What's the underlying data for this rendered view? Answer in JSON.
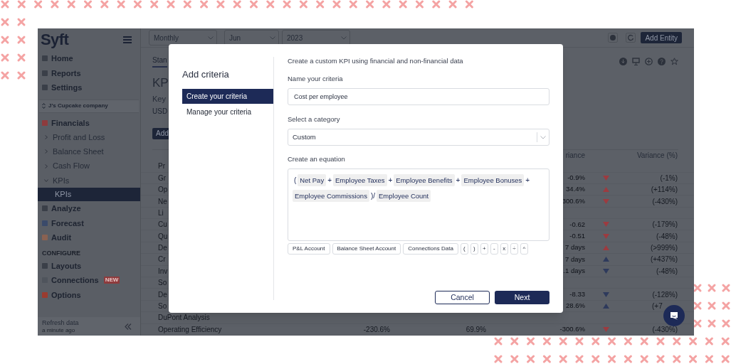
{
  "sidebar": {
    "logo": "Syft",
    "top_items": [
      {
        "label": "Home",
        "selected": false
      },
      {
        "label": "Reports",
        "selected": false
      },
      {
        "label": "Settings",
        "selected": false
      }
    ],
    "company": "J's Cupcake company",
    "financials": {
      "label": "Financials",
      "selected": false,
      "children": [
        {
          "label": "Profit and Loss",
          "expanded": false,
          "selected": false
        },
        {
          "label": "Balance Sheet",
          "expanded": false,
          "selected": false
        },
        {
          "label": "Cash Flow",
          "expanded": false,
          "selected": false
        },
        {
          "label": "KPIs",
          "expanded": true,
          "selected": false,
          "children": [
            {
              "label": "KPIs",
              "selected": true
            }
          ]
        }
      ]
    },
    "tool_items": [
      {
        "label": "Analyze",
        "selected": false
      },
      {
        "label": "Forecast",
        "selected": false
      },
      {
        "label": "Audit",
        "selected": false
      }
    ],
    "configure_heading": "CONFIGURE",
    "configure_items": [
      {
        "label": "Layouts",
        "selected": false
      },
      {
        "label": "Connections",
        "badge": "NEW",
        "selected": false
      },
      {
        "label": "Options",
        "selected": false
      }
    ],
    "refresh": {
      "label": "Refresh data",
      "time": "a minute ago"
    }
  },
  "toolbar": {
    "period": "Monthly",
    "month": "Jun",
    "year": "2023",
    "add_entity": "Add Entity"
  },
  "tab": "Stan",
  "heading": "KP",
  "subtitle": "Key",
  "currency": "USD",
  "add_button": "Add",
  "table": {
    "variance_header": "riance",
    "variance_pct_header": "Variance (%)",
    "rows": [
      {
        "kind": "section",
        "label": "Pr"
      },
      {
        "kind": "metric",
        "label": "Gr",
        "variance": "-0.9%",
        "trend_up": false,
        "color": "#9c3b40",
        "variance_pct": "(-1%)"
      },
      {
        "kind": "metric",
        "label": "Op",
        "variance": "34.4%",
        "trend_up": true,
        "color": "#9c3b40",
        "variance_pct": "(+114%)"
      },
      {
        "kind": "metric",
        "label": "Ne",
        "variance": "300.6%",
        "trend_up": false,
        "color": "#9c3b40",
        "variance_pct": "(-430%)"
      },
      {
        "kind": "section",
        "label": "Li"
      },
      {
        "kind": "metric",
        "label": "Cu",
        "variance": "-0.62",
        "trend_up": false,
        "color": "#9c3b40",
        "variance_pct": "(-179%)"
      },
      {
        "kind": "metric",
        "label": "Qu",
        "variance": "-0.51",
        "trend_up": false,
        "color": "#9c3b40",
        "variance_pct": "(-48%)"
      },
      {
        "kind": "metric",
        "label": "De",
        "variance": "7 days",
        "trend_up": true,
        "color": "#9c3b40",
        "variance_pct": "(>999%)"
      },
      {
        "kind": "metric",
        "label": "Cr",
        "variance": "7 days",
        "trend_up": true,
        "color": "#2e3a5c",
        "variance_pct": "(+437%)"
      },
      {
        "kind": "metric",
        "label": "Inv",
        "variance": ".1 days",
        "trend_up": false,
        "color": "#2e3a5c",
        "variance_pct": "(-48%)"
      },
      {
        "kind": "section",
        "label": "So"
      },
      {
        "kind": "metric",
        "label": "De",
        "variance": "-8.33",
        "trend_up": false,
        "color": "#2e3a5c",
        "variance_pct": "(-128%)"
      },
      {
        "kind": "metric",
        "label": "So",
        "variance": "28.6%",
        "trend_up": true,
        "color": "#2e3a5c",
        "variance_pct": "(+7",
        "variance_pct_cut": true
      },
      {
        "kind": "section",
        "label": "DuPont Analysis"
      },
      {
        "kind": "metric",
        "label": "Operating Efficiency",
        "value_1": "-230.6%",
        "value_2": "69.9%",
        "variance": "-300.6%",
        "trend_up": false,
        "color": "#9c3b40",
        "variance_pct": "(-430%)"
      }
    ]
  },
  "modal": {
    "title": "Add criteria",
    "nav": [
      {
        "label": "Create your criteria",
        "selected": true
      },
      {
        "label": "Manage your criteria",
        "selected": false
      }
    ],
    "intro": "Create a custom KPI using financial and non-financial data",
    "name_label": "Name your criteria",
    "name_value": "Cost per employee",
    "category_label": "Select a category",
    "category_value": "Custom",
    "equation_label": "Create an equation",
    "equation": [
      {
        "kind": "symbol",
        "text": "("
      },
      {
        "kind": "token",
        "text": "Net Pay"
      },
      {
        "kind": "symbol",
        "text": "+"
      },
      {
        "kind": "token",
        "text": "Employee Taxes"
      },
      {
        "kind": "symbol",
        "text": "+"
      },
      {
        "kind": "token",
        "text": "Employee Benefits"
      },
      {
        "kind": "symbol",
        "text": "+"
      },
      {
        "kind": "token",
        "text": "Employee Bonuses"
      },
      {
        "kind": "symbol",
        "text": "+"
      },
      {
        "kind": "token",
        "text": "Employee Commissions"
      },
      {
        "kind": "symbol",
        "text": ")/"
      },
      {
        "kind": "token",
        "text": "Employee Count"
      }
    ],
    "insert_buttons": [
      "P&L Account",
      "Balance Sheet Account",
      "Connections Data",
      "(",
      ")",
      "+",
      "-",
      "x",
      "÷",
      "^"
    ],
    "cancel": "Cancel",
    "next": "Next"
  }
}
